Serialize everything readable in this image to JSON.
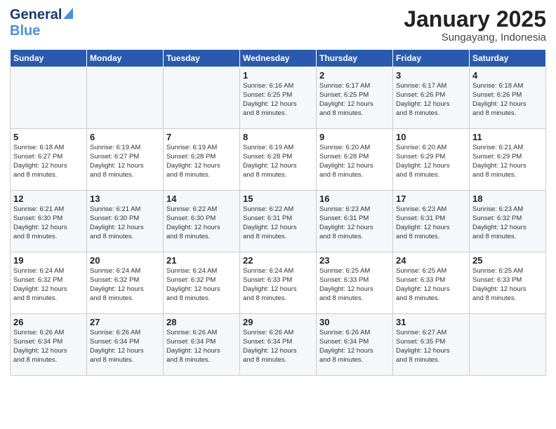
{
  "logo": {
    "line1": "General",
    "line2": "Blue"
  },
  "title": "January 2025",
  "location": "Sungayang, Indonesia",
  "weekdays": [
    "Sunday",
    "Monday",
    "Tuesday",
    "Wednesday",
    "Thursday",
    "Friday",
    "Saturday"
  ],
  "weeks": [
    [
      {
        "day": "",
        "info": ""
      },
      {
        "day": "",
        "info": ""
      },
      {
        "day": "",
        "info": ""
      },
      {
        "day": "1",
        "info": "Sunrise: 6:16 AM\nSunset: 6:25 PM\nDaylight: 12 hours\nand 8 minutes."
      },
      {
        "day": "2",
        "info": "Sunrise: 6:17 AM\nSunset: 6:25 PM\nDaylight: 12 hours\nand 8 minutes."
      },
      {
        "day": "3",
        "info": "Sunrise: 6:17 AM\nSunset: 6:26 PM\nDaylight: 12 hours\nand 8 minutes."
      },
      {
        "day": "4",
        "info": "Sunrise: 6:18 AM\nSunset: 6:26 PM\nDaylight: 12 hours\nand 8 minutes."
      }
    ],
    [
      {
        "day": "5",
        "info": "Sunrise: 6:18 AM\nSunset: 6:27 PM\nDaylight: 12 hours\nand 8 minutes."
      },
      {
        "day": "6",
        "info": "Sunrise: 6:19 AM\nSunset: 6:27 PM\nDaylight: 12 hours\nand 8 minutes."
      },
      {
        "day": "7",
        "info": "Sunrise: 6:19 AM\nSunset: 6:28 PM\nDaylight: 12 hours\nand 8 minutes."
      },
      {
        "day": "8",
        "info": "Sunrise: 6:19 AM\nSunset: 6:28 PM\nDaylight: 12 hours\nand 8 minutes."
      },
      {
        "day": "9",
        "info": "Sunrise: 6:20 AM\nSunset: 6:28 PM\nDaylight: 12 hours\nand 8 minutes."
      },
      {
        "day": "10",
        "info": "Sunrise: 6:20 AM\nSunset: 6:29 PM\nDaylight: 12 hours\nand 8 minutes."
      },
      {
        "day": "11",
        "info": "Sunrise: 6:21 AM\nSunset: 6:29 PM\nDaylight: 12 hours\nand 8 minutes."
      }
    ],
    [
      {
        "day": "12",
        "info": "Sunrise: 6:21 AM\nSunset: 6:30 PM\nDaylight: 12 hours\nand 8 minutes."
      },
      {
        "day": "13",
        "info": "Sunrise: 6:21 AM\nSunset: 6:30 PM\nDaylight: 12 hours\nand 8 minutes."
      },
      {
        "day": "14",
        "info": "Sunrise: 6:22 AM\nSunset: 6:30 PM\nDaylight: 12 hours\nand 8 minutes."
      },
      {
        "day": "15",
        "info": "Sunrise: 6:22 AM\nSunset: 6:31 PM\nDaylight: 12 hours\nand 8 minutes."
      },
      {
        "day": "16",
        "info": "Sunrise: 6:23 AM\nSunset: 6:31 PM\nDaylight: 12 hours\nand 8 minutes."
      },
      {
        "day": "17",
        "info": "Sunrise: 6:23 AM\nSunset: 6:31 PM\nDaylight: 12 hours\nand 8 minutes."
      },
      {
        "day": "18",
        "info": "Sunrise: 6:23 AM\nSunset: 6:32 PM\nDaylight: 12 hours\nand 8 minutes."
      }
    ],
    [
      {
        "day": "19",
        "info": "Sunrise: 6:24 AM\nSunset: 6:32 PM\nDaylight: 12 hours\nand 8 minutes."
      },
      {
        "day": "20",
        "info": "Sunrise: 6:24 AM\nSunset: 6:32 PM\nDaylight: 12 hours\nand 8 minutes."
      },
      {
        "day": "21",
        "info": "Sunrise: 6:24 AM\nSunset: 6:32 PM\nDaylight: 12 hours\nand 8 minutes."
      },
      {
        "day": "22",
        "info": "Sunrise: 6:24 AM\nSunset: 6:33 PM\nDaylight: 12 hours\nand 8 minutes."
      },
      {
        "day": "23",
        "info": "Sunrise: 6:25 AM\nSunset: 6:33 PM\nDaylight: 12 hours\nand 8 minutes."
      },
      {
        "day": "24",
        "info": "Sunrise: 6:25 AM\nSunset: 6:33 PM\nDaylight: 12 hours\nand 8 minutes."
      },
      {
        "day": "25",
        "info": "Sunrise: 6:25 AM\nSunset: 6:33 PM\nDaylight: 12 hours\nand 8 minutes."
      }
    ],
    [
      {
        "day": "26",
        "info": "Sunrise: 6:26 AM\nSunset: 6:34 PM\nDaylight: 12 hours\nand 8 minutes."
      },
      {
        "day": "27",
        "info": "Sunrise: 6:26 AM\nSunset: 6:34 PM\nDaylight: 12 hours\nand 8 minutes."
      },
      {
        "day": "28",
        "info": "Sunrise: 6:26 AM\nSunset: 6:34 PM\nDaylight: 12 hours\nand 8 minutes."
      },
      {
        "day": "29",
        "info": "Sunrise: 6:26 AM\nSunset: 6:34 PM\nDaylight: 12 hours\nand 8 minutes."
      },
      {
        "day": "30",
        "info": "Sunrise: 6:26 AM\nSunset: 6:34 PM\nDaylight: 12 hours\nand 8 minutes."
      },
      {
        "day": "31",
        "info": "Sunrise: 6:27 AM\nSunset: 6:35 PM\nDaylight: 12 hours\nand 8 minutes."
      },
      {
        "day": "",
        "info": ""
      }
    ]
  ]
}
